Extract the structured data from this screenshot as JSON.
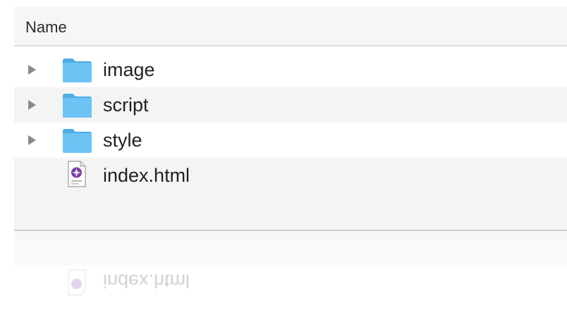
{
  "header": {
    "name_column": "Name"
  },
  "rows": [
    {
      "name": "image",
      "kind": "folder",
      "icon": "folder-icon"
    },
    {
      "name": "script",
      "kind": "folder",
      "icon": "folder-icon"
    },
    {
      "name": "style",
      "kind": "folder",
      "icon": "folder-icon"
    },
    {
      "name": "index.html",
      "kind": "file",
      "icon": "html-file-icon"
    }
  ],
  "reflection": {
    "name": "index.html"
  },
  "colors": {
    "folder": "#6cc3f4",
    "folder_dark": "#4daee6",
    "row_alt": "#f4f4f4",
    "text": "#222222"
  }
}
